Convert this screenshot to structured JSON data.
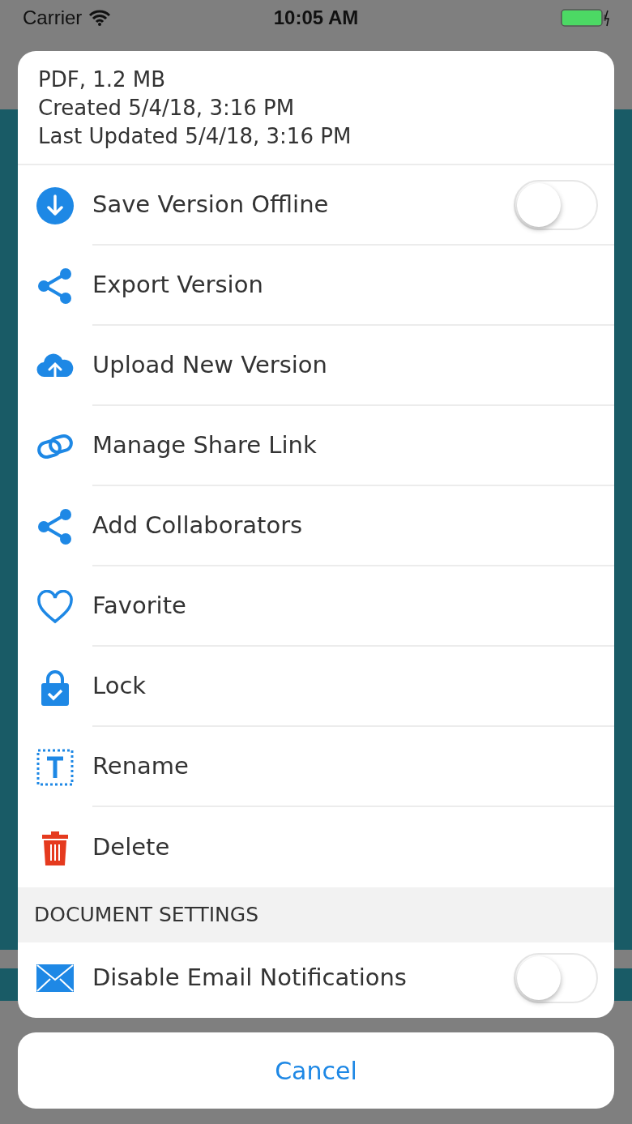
{
  "status_bar": {
    "carrier": "Carrier",
    "time": "10:05 AM"
  },
  "file_info": [
    "PDF, 1.2 MB",
    "Created 5/4/18, 3:16 PM",
    "Last Updated 5/4/18, 3:16 PM"
  ],
  "actions": [
    {
      "label": "Save Version Offline",
      "kind": "toggle",
      "on": false
    },
    {
      "label": "Export Version",
      "kind": "action"
    },
    {
      "label": "Upload New Version",
      "kind": "action"
    },
    {
      "label": "Manage Share Link",
      "kind": "action"
    },
    {
      "label": "Add Collaborators",
      "kind": "action"
    },
    {
      "label": "Favorite",
      "kind": "action"
    },
    {
      "label": "Lock",
      "kind": "action"
    },
    {
      "label": "Rename",
      "kind": "action"
    },
    {
      "label": "Delete",
      "kind": "action"
    }
  ],
  "document_settings": {
    "title": "DOCUMENT SETTINGS",
    "items": [
      {
        "label": "Disable Email Notifications",
        "kind": "toggle",
        "on": false
      }
    ]
  },
  "cancel": "Cancel"
}
